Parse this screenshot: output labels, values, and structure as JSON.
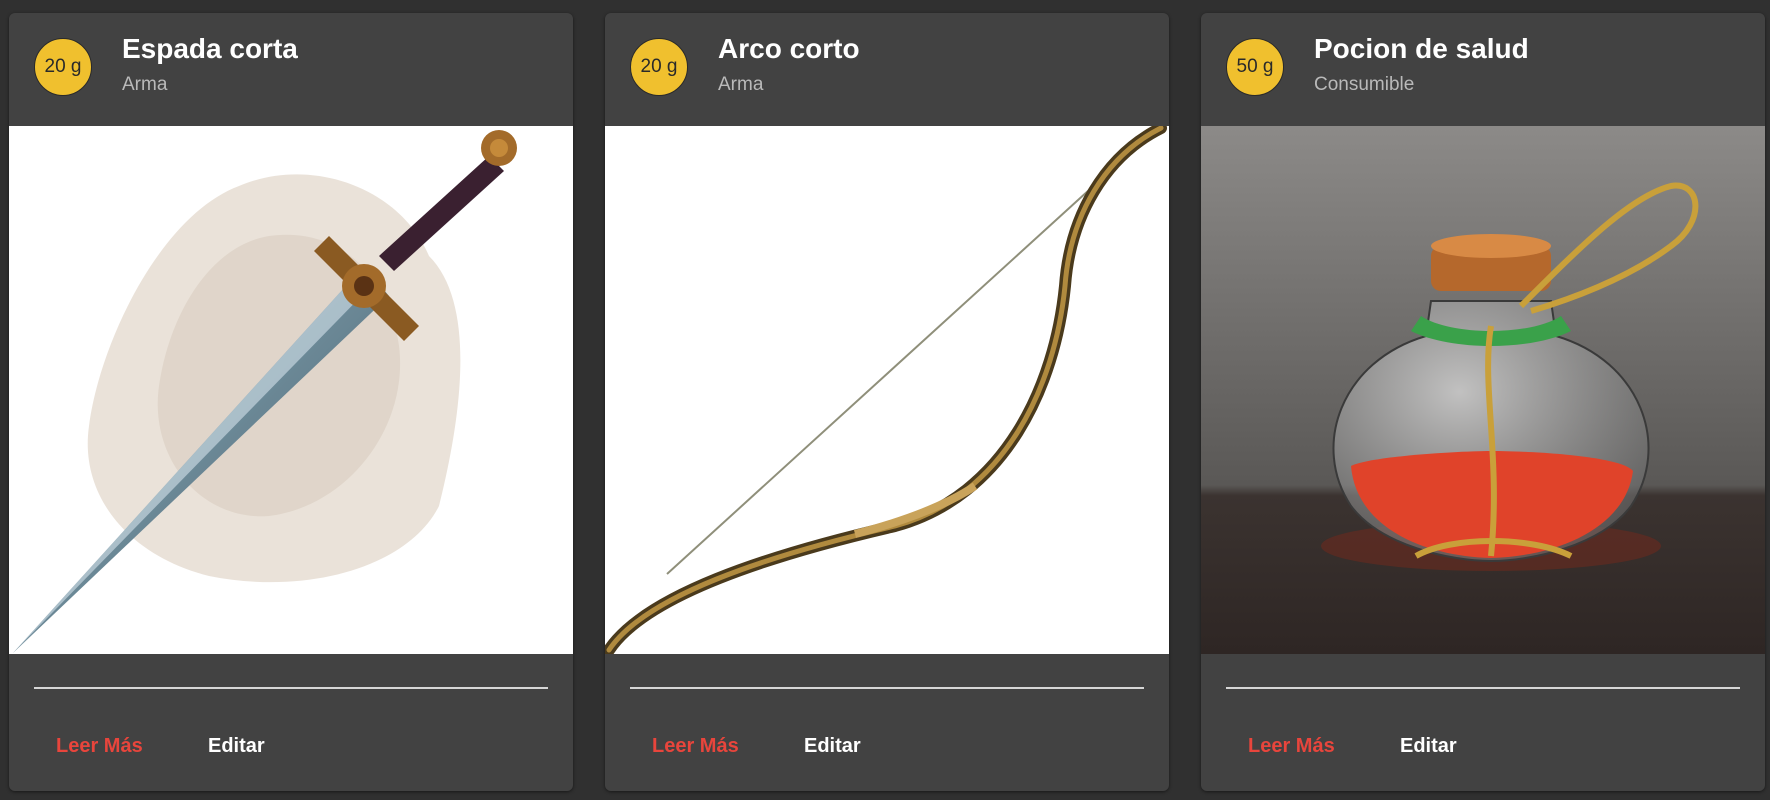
{
  "cards": [
    {
      "price": "20 g",
      "title": "Espada corta",
      "category": "Arma",
      "image": "short-sword",
      "read_more": "Leer Más",
      "edit": "Editar"
    },
    {
      "price": "20 g",
      "title": "Arco corto",
      "category": "Arma",
      "image": "short-bow",
      "read_more": "Leer Más",
      "edit": "Editar"
    },
    {
      "price": "50 g",
      "title": "Pocion de salud",
      "category": "Consumible",
      "image": "health-potion",
      "read_more": "Leer Más",
      "edit": "Editar"
    }
  ],
  "colors": {
    "page_background": "#303030",
    "card_background": "#424242",
    "price_badge": "#f0c02e",
    "read_more_link": "#e8453c",
    "edit_link": "#ffffff",
    "subtitle_text": "#b9b9b9"
  }
}
